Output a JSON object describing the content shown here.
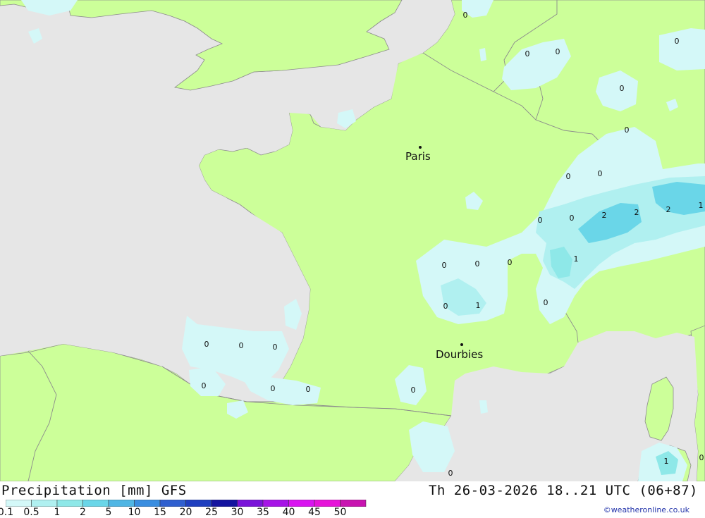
{
  "title": "Precipitation [mm] GFS",
  "validity": "Th 26-03-2026 18..21 UTC (06+87)",
  "credit": "©weatheronline.co.uk",
  "colors": {
    "sea": "#e6e6e6",
    "land": "#ccff99",
    "border": "#8c8c8c",
    "coast": "#8c8c8c",
    "precip_0_1": "#d4f8f8",
    "precip_1": "#aff0f0",
    "precip_2": "#78dbe8"
  },
  "legend": {
    "labels": [
      "0.1",
      "0.5",
      "1",
      "2",
      "5",
      "10",
      "15",
      "20",
      "25",
      "30",
      "35",
      "40",
      "45",
      "50"
    ],
    "colors": [
      "#d4f8f8",
      "#b0f0f0",
      "#8ee8e8",
      "#6ad6e8",
      "#50b6e4",
      "#3a8ee0",
      "#2f5fcf",
      "#1f3fbf",
      "#14149f",
      "#7a14d9",
      "#a614e6",
      "#d914f0",
      "#e614d9",
      "#c814b0"
    ]
  },
  "cities": [
    {
      "name": "Paris"
    },
    {
      "name": "Dourbies"
    }
  ],
  "values": [
    "0",
    "0",
    "0",
    "0",
    "0",
    "0",
    "0",
    "0",
    "0",
    "0",
    "1",
    "0",
    "2",
    "2",
    "2",
    "1",
    "0",
    "0",
    "0",
    "1",
    "0",
    "0",
    "0",
    "0",
    "0",
    "0",
    "0",
    "0",
    "0",
    "1",
    "0",
    "0",
    "0",
    "0"
  ]
}
